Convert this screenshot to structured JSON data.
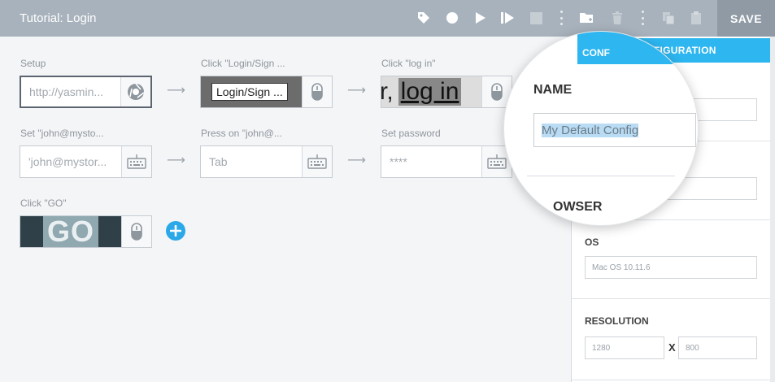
{
  "toolbar": {
    "title": "Tutorial: Login",
    "save_label": "SAVE"
  },
  "steps": [
    {
      "label": "Setup",
      "value": "http://yasmin..."
    },
    {
      "label": "Click \"Login/Sign ...",
      "value": "Login/Sign ..."
    },
    {
      "label": "Click \"log in\"",
      "value_prefix": "r,",
      "value": "log in"
    },
    {
      "label": "Set \"john@mysto...",
      "value": "'john@mystor..."
    },
    {
      "label": "Press on \"john@...",
      "value": "Tab"
    },
    {
      "label": "Set password",
      "value": "****"
    },
    {
      "label": "Click \"GO\"",
      "value": "GO"
    }
  ],
  "panel": {
    "header": "CONFIGURATION",
    "name_label": "NAME",
    "name_value": "My Default Config",
    "browser_label": "BROWSER",
    "os_label": "OS",
    "os_value": "Mac OS 10.11.6",
    "resolution_label": "RESOLUTION",
    "res_width": "1280",
    "res_sep": "X",
    "res_height": "800"
  },
  "magnifier": {
    "header_partial": "CONF",
    "browser_partial": "OWSER"
  }
}
